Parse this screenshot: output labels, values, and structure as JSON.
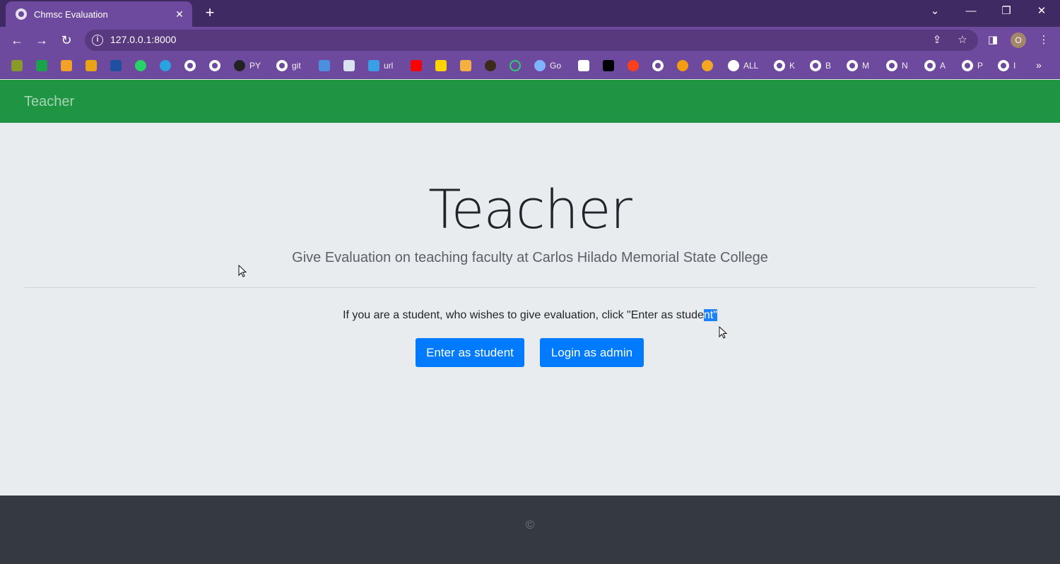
{
  "browser": {
    "tab_title": "Chmsc Evaluation",
    "url": "127.0.0.1:8000",
    "avatar_letter": "O",
    "bookmarks": [
      "PY",
      "git",
      "url",
      "Go",
      "ALL",
      "K",
      "B",
      "M",
      "N",
      "A",
      "P",
      "I"
    ]
  },
  "navbar": {
    "brand": "Teacher"
  },
  "hero": {
    "title": "Teacher",
    "lead": "Give Evaluation on teaching faculty at Carlos Hilado Memorial State College",
    "prompt_main": "If you are a student, who wishes to give evaluation, click \"Enter as stude",
    "prompt_selected": "nt\""
  },
  "buttons": {
    "student": "Enter as student",
    "admin": "Login as admin"
  },
  "footer": {
    "copyright": "©"
  },
  "colors": {
    "navbar": "#1f9442",
    "button": "#007bff",
    "footer": "#343a40",
    "chrome": "#6e4a9e"
  }
}
